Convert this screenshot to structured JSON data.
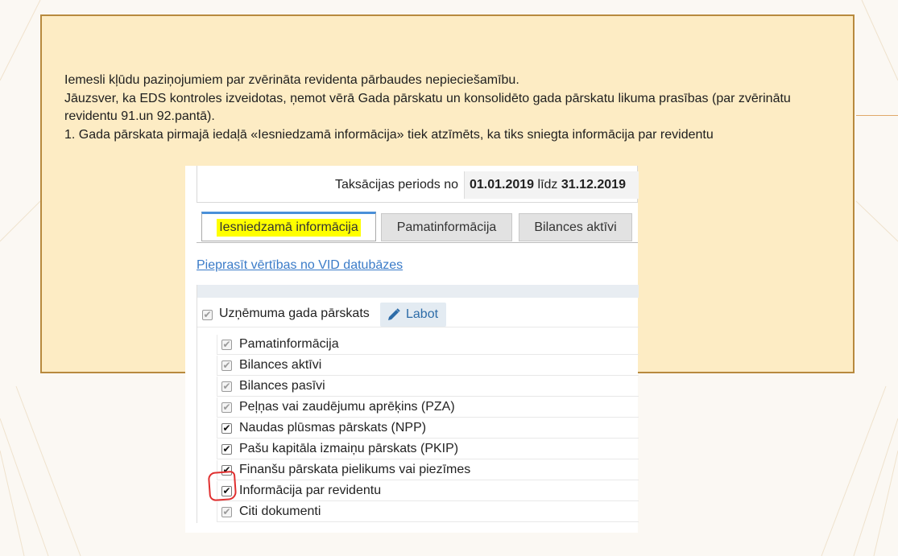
{
  "slide": {
    "lines": [
      "Iemesli kļūdu paziņojumiem par zvērināta revidenta pārbaudes nepieciešamību.",
      "Jāuzsver, ka EDS kontroles izveidotas, ņemot vērā Gada pārskatu un konsolidēto gada pārskatu likuma prasības (par zvērinātu revidentu 91.un 92.pantā).",
      "1. Gada pārskata pirmajā iedaļā «Iesniedzamā informācija» tiek atzīmēts, ka tiks sniegta informācija par revidentu"
    ]
  },
  "screenshot": {
    "period_label": "Taksācijas periods no",
    "period_from": "01.01.2019",
    "period_mid": "līdz",
    "period_to": "31.12.2019",
    "tabs": [
      {
        "label": "Iesniedzamā informācija",
        "active": true
      },
      {
        "label": "Pamatinformācija",
        "active": false
      },
      {
        "label": "Bilances aktīvi",
        "active": false
      }
    ],
    "vid_link": "Pieprasīt vērtības no VID datubāzes",
    "root_item": "Uzņēmuma gada pārskats",
    "edit_button": "Labot",
    "items": [
      {
        "label": "Pamatinformācija",
        "checked": true,
        "enabled": false
      },
      {
        "label": "Bilances aktīvi",
        "checked": true,
        "enabled": false
      },
      {
        "label": "Bilances pasīvi",
        "checked": true,
        "enabled": false
      },
      {
        "label": "Peļņas vai zaudējumu aprēķins (PZA)",
        "checked": true,
        "enabled": false
      },
      {
        "label": "Naudas plūsmas pārskats (NPP)",
        "checked": true,
        "enabled": true
      },
      {
        "label": "Pašu kapitāla izmaiņu pārskats (PKIP)",
        "checked": true,
        "enabled": true
      },
      {
        "label": "Finanšu pārskata pielikums vai piezīmes",
        "checked": true,
        "enabled": true
      },
      {
        "label": "Informācija par revidentu",
        "checked": true,
        "enabled": true
      },
      {
        "label": "Citi dokumenti",
        "checked": true,
        "enabled": false
      }
    ]
  },
  "colors": {
    "slide_fill": "#fdecc4",
    "slide_border": "#b88a3e",
    "highlight": "#ffff00",
    "link": "#3a7bc8",
    "annotation": "#e03030"
  }
}
